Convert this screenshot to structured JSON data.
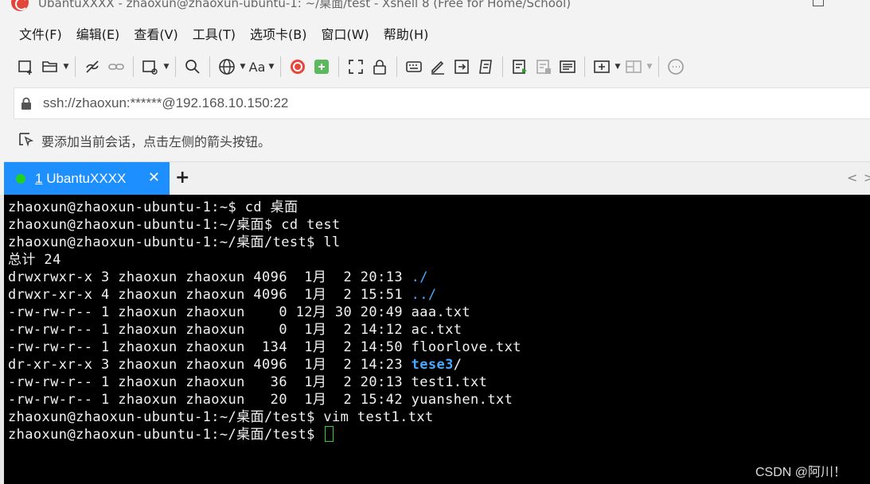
{
  "window": {
    "title": "UbantuXXXX - zhaoxun@zhaoxun-ubuntu-1: ~/桌面/test - Xshell 8 (Free for Home/School)"
  },
  "menubar": {
    "items": [
      {
        "label": "文件(F)"
      },
      {
        "label": "编辑(E)"
      },
      {
        "label": "查看(V)"
      },
      {
        "label": "工具(T)"
      },
      {
        "label": "选项卡(B)"
      },
      {
        "label": "窗口(W)"
      },
      {
        "label": "帮助(H)"
      }
    ]
  },
  "toolbar": {
    "font_button_label": "Aa"
  },
  "address": {
    "value": "ssh://zhaoxun:******@192.168.10.150:22"
  },
  "hint": {
    "text": "要添加当前会话，点击左侧的箭头按钮。"
  },
  "tabs": {
    "active": {
      "number": "1",
      "name": " UbantuXXXX",
      "status_color": "#22d022"
    },
    "add_label": "+",
    "close_label": "✕"
  },
  "terminal": {
    "lines": [
      {
        "text": "zhaoxun@zhaoxun-ubuntu-1:~$ cd 桌面"
      },
      {
        "text": "zhaoxun@zhaoxun-ubuntu-1:~/桌面$ cd test"
      },
      {
        "text": "zhaoxun@zhaoxun-ubuntu-1:~/桌面/test$ ll"
      },
      {
        "text": "总计 24"
      },
      {
        "prefix": "drwxrwxr-x 3 zhaoxun zhaoxun 4096  1月  2 20:13 ",
        "name": "./",
        "kind": "dir"
      },
      {
        "prefix": "drwxr-xr-x 4 zhaoxun zhaoxun 4096  1月  2 15:51 ",
        "name": "../",
        "kind": "dir"
      },
      {
        "text": "-rw-rw-r-- 1 zhaoxun zhaoxun    0 12月 30 20:49 aaa.txt"
      },
      {
        "text": "-rw-rw-r-- 1 zhaoxun zhaoxun    0  1月  2 14:12 ac.txt"
      },
      {
        "text": "-rw-rw-r-- 1 zhaoxun zhaoxun  134  1月  2 14:50 floorlove.txt"
      },
      {
        "prefix": "dr-xr-xr-x 3 zhaoxun zhaoxun 4096  1月  2 14:23 ",
        "name": "tese3",
        "suffix": "/",
        "kind": "dir-bold"
      },
      {
        "text": "-rw-rw-r-- 1 zhaoxun zhaoxun   36  1月  2 20:13 test1.txt"
      },
      {
        "text": "-rw-rw-r-- 1 zhaoxun zhaoxun   20  1月  2 15:42 yuanshen.txt"
      },
      {
        "text": "zhaoxun@zhaoxun-ubuntu-1:~/桌面/test$ vim test1.txt"
      },
      {
        "text": "zhaoxun@zhaoxun-ubuntu-1:~/桌面/test$ ",
        "cursor": true
      }
    ],
    "colors": {
      "background": "#000000",
      "text": "#f2f2f2",
      "directory": "#4aa8ff",
      "cursor": "#2ed22e"
    }
  },
  "watermark": "CSDN @阿川！"
}
